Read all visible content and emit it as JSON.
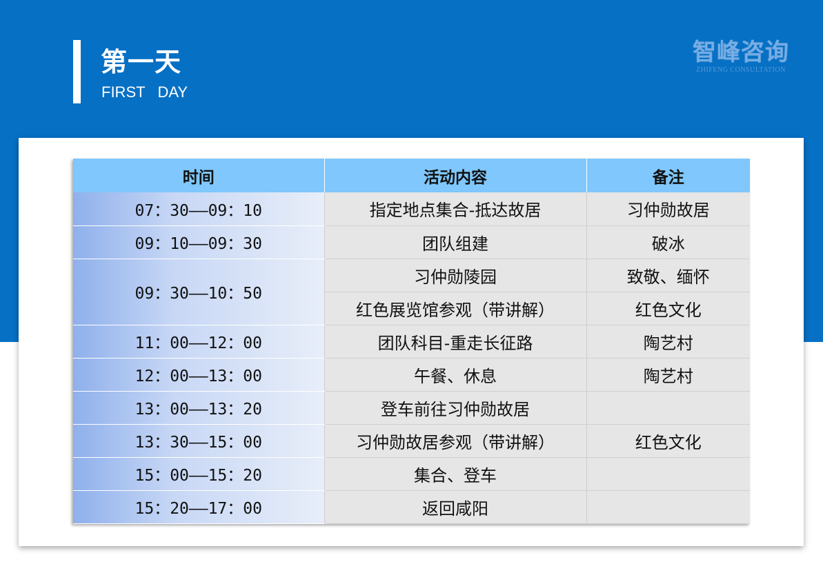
{
  "header": {
    "title_cn": "第一天",
    "title_en": "FIRST   DAY"
  },
  "logo": {
    "name_cn": "智峰咨询",
    "name_en": "ZHIFENG CONSULTATION"
  },
  "colors": {
    "header_band": "#0670c4",
    "table_header": "#7fc7fc",
    "time_gradient_start": "#8fb0ec",
    "cell_gray": "#e6e6e6"
  },
  "table": {
    "headers": [
      "时间",
      "活动内容",
      "备注"
    ],
    "rows": [
      {
        "time": "07：30——09：10",
        "activities": [
          {
            "activity": "指定地点集合-抵达故居",
            "note": "习仲勋故居"
          }
        ]
      },
      {
        "time": "09：10——09：30",
        "activities": [
          {
            "activity": "团队组建",
            "note": "破冰"
          }
        ]
      },
      {
        "time": "09：30——10：50",
        "activities": [
          {
            "activity": "习仲勋陵园",
            "note": "致敬、缅怀"
          },
          {
            "activity": "红色展览馆参观（带讲解）",
            "note": "红色文化"
          }
        ]
      },
      {
        "time": "11：00——12：00",
        "activities": [
          {
            "activity": "团队科目-重走长征路",
            "note": "陶艺村"
          }
        ]
      },
      {
        "time": "12：00——13：00",
        "activities": [
          {
            "activity": "午餐、休息",
            "note": "陶艺村"
          }
        ]
      },
      {
        "time": "13：00——13：20",
        "activities": [
          {
            "activity": "登车前往习仲勋故居",
            "note": ""
          }
        ]
      },
      {
        "time": "13：30——15：00",
        "activities": [
          {
            "activity": "习仲勋故居参观（带讲解）",
            "note": "红色文化"
          }
        ]
      },
      {
        "time": "15：00——15：20",
        "activities": [
          {
            "activity": "集合、登车",
            "note": ""
          }
        ]
      },
      {
        "time": "15：20——17：00",
        "activities": [
          {
            "activity": "返回咸阳",
            "note": ""
          }
        ]
      }
    ]
  }
}
